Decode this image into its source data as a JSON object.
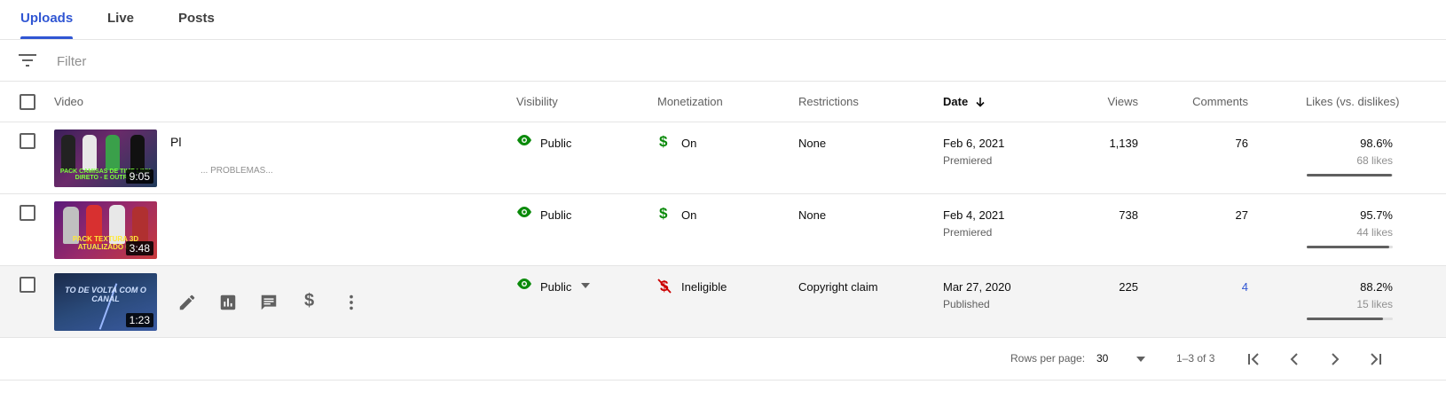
{
  "tabs": [
    {
      "label": "Uploads",
      "active": true
    },
    {
      "label": "Live",
      "active": false
    },
    {
      "label": "Posts",
      "active": false
    }
  ],
  "filter": {
    "placeholder": "Filter",
    "icon": "filter-list-icon"
  },
  "columns": {
    "video": "Video",
    "visibility": "Visibility",
    "monetization": "Monetization",
    "restrictions": "Restrictions",
    "date": "Date",
    "views": "Views",
    "comments": "Comments",
    "likes": "Likes (vs. dislikes)"
  },
  "rows": [
    {
      "title": "Pl",
      "description": "... PROBLEMAS... ",
      "thumb_text": "PACK CAMISAS DE TIME LINK DIRETO - E OUTRAS",
      "duration": "9:05",
      "visibility": "Public",
      "monetization": "On",
      "restrictions": "None",
      "date": "Feb 6, 2021",
      "date_sub": "Premiered",
      "views": "1,139",
      "comments": "76",
      "likes_pct": "98.6%",
      "likes_count": "68 likes",
      "likes_ratio": 0.986
    },
    {
      "title": "",
      "description": "",
      "thumb_text": "PACK TEXTURA 3D ATUALIZADO 01",
      "duration": "3:48",
      "visibility": "Public",
      "monetization": "On",
      "restrictions": "None",
      "date": "Feb 4, 2021",
      "date_sub": "Premiered",
      "views": "738",
      "comments": "27",
      "likes_pct": "95.7%",
      "likes_count": "44 likes",
      "likes_ratio": 0.957
    },
    {
      "title": "",
      "description": "",
      "thumb_text": "TO DE VOLTA COM O CANAL",
      "duration": "1:23",
      "visibility": "Public",
      "monetization": "Ineligible",
      "restrictions": "Copyright claim",
      "date": "Mar 27, 2020",
      "date_sub": "Published",
      "views": "225",
      "comments": "4",
      "likes_pct": "88.2%",
      "likes_count": "15 likes",
      "likes_ratio": 0.882
    }
  ],
  "footer": {
    "rows_per_page_label": "Rows per page:",
    "rows_per_page_value": "30",
    "range": "1–3 of 3"
  },
  "colors": {
    "accent": "#3056d3",
    "public_green": "#0a8a0a",
    "ineligible_red": "#cc0000"
  }
}
